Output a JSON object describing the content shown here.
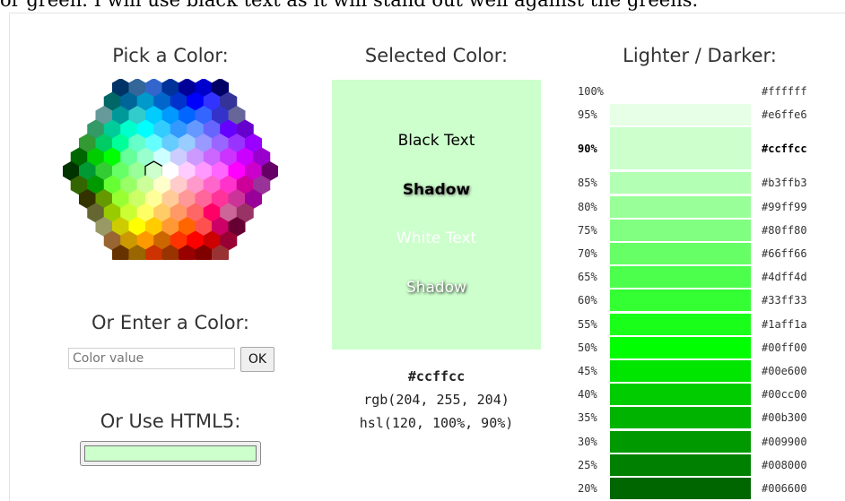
{
  "page_intro": "or green. I will use black text as it will stand out well against the greens.",
  "picker": {
    "heading": "Pick a Color:",
    "hex_colors": [
      [
        "#003366",
        "#336699",
        "#3366CC",
        "#003399",
        "#000099",
        "#0000CC",
        "#000066"
      ],
      [
        "#006666",
        "#006699",
        "#0099CC",
        "#0066CC",
        "#0033CC",
        "#0000FF",
        "#3333FF",
        "#333399"
      ],
      [
        "#669999",
        "#009999",
        "#33CCCC",
        "#00CCFF",
        "#0099FF",
        "#0066FF",
        "#3366FF",
        "#3333CC",
        "#666699"
      ],
      [
        "#339966",
        "#00CC99",
        "#00FFCC",
        "#00FFFF",
        "#33CCFF",
        "#3399FF",
        "#6699FF",
        "#6666FF",
        "#6600FF",
        "#6600CC"
      ],
      [
        "#339933",
        "#00CC66",
        "#00FF99",
        "#66FFCC",
        "#66FFFF",
        "#66CCFF",
        "#99CCFF",
        "#9999FF",
        "#9966FF",
        "#9933FF",
        "#9900FF"
      ],
      [
        "#006600",
        "#00CC00",
        "#00FF00",
        "#66FF99",
        "#99FFCC",
        "#CCFFFF",
        "#CCCCFF",
        "#CC99FF",
        "#CC66FF",
        "#CC33FF",
        "#CC00FF",
        "#9900CC"
      ],
      [
        "#003300",
        "#009933",
        "#33CC33",
        "#66FF66",
        "#99FF99",
        "#CCFFCC",
        "#FFFFFF",
        "#FFCCFF",
        "#FF99FF",
        "#FF66FF",
        "#FF00FF",
        "#CC00CC",
        "#660066"
      ],
      [
        "#336600",
        "#009900",
        "#66FF33",
        "#99FF66",
        "#CCFF99",
        "#FFFFCC",
        "#FFCCCC",
        "#FF99CC",
        "#FF66CC",
        "#FF33CC",
        "#CC0099",
        "#993399"
      ],
      [
        "#333300",
        "#669900",
        "#99FF33",
        "#CCFF66",
        "#FFFF99",
        "#FFCC99",
        "#FF9999",
        "#FF6699",
        "#FF3399",
        "#CC3399",
        "#990099"
      ],
      [
        "#666633",
        "#99CC00",
        "#CCFF33",
        "#FFFF66",
        "#FFCC66",
        "#FF9966",
        "#FF6666",
        "#FF0066",
        "#CC6699",
        "#993366"
      ],
      [
        "#999966",
        "#CCCC00",
        "#FFFF00",
        "#FFCC00",
        "#FF9933",
        "#FF6600",
        "#FF5050",
        "#CC0066",
        "#660033"
      ],
      [
        "#996633",
        "#CC9900",
        "#FF9900",
        "#CC6600",
        "#FF3300",
        "#FF0000",
        "#CC0000",
        "#990033"
      ],
      [
        "#663300",
        "#996600",
        "#CC3300",
        "#993300",
        "#990000",
        "#800000",
        "#993333"
      ]
    ],
    "selected_hex": "#CCFFCC"
  },
  "enter": {
    "heading": "Or Enter a Color:",
    "placeholder": "Color value",
    "ok_label": "OK"
  },
  "html5": {
    "heading": "Or Use HTML5:",
    "value": "#ccffcc"
  },
  "selected": {
    "heading": "Selected Color:",
    "color": "#ccffcc",
    "black_text": "Black Text",
    "black_shadow": "Shadow",
    "white_text": "White Text",
    "white_shadow": "Shadow",
    "hex": "#ccffcc",
    "rgb": "rgb(204, 255, 204)",
    "hsl": "hsl(120, 100%, 90%)"
  },
  "shades": {
    "heading": "Lighter / Darker:",
    "rows": [
      {
        "pct": "100%",
        "hex": "#ffffff",
        "selected": false
      },
      {
        "pct": "95%",
        "hex": "#e6ffe6",
        "selected": false
      },
      {
        "pct": "90%",
        "hex": "#ccffcc",
        "selected": true
      },
      {
        "pct": "85%",
        "hex": "#b3ffb3",
        "selected": false
      },
      {
        "pct": "80%",
        "hex": "#99ff99",
        "selected": false
      },
      {
        "pct": "75%",
        "hex": "#80ff80",
        "selected": false
      },
      {
        "pct": "70%",
        "hex": "#66ff66",
        "selected": false
      },
      {
        "pct": "65%",
        "hex": "#4dff4d",
        "selected": false
      },
      {
        "pct": "60%",
        "hex": "#33ff33",
        "selected": false
      },
      {
        "pct": "55%",
        "hex": "#1aff1a",
        "selected": false
      },
      {
        "pct": "50%",
        "hex": "#00ff00",
        "selected": false
      },
      {
        "pct": "45%",
        "hex": "#00e600",
        "selected": false
      },
      {
        "pct": "40%",
        "hex": "#00cc00",
        "selected": false
      },
      {
        "pct": "35%",
        "hex": "#00b300",
        "selected": false
      },
      {
        "pct": "30%",
        "hex": "#009900",
        "selected": false
      },
      {
        "pct": "25%",
        "hex": "#008000",
        "selected": false
      },
      {
        "pct": "20%",
        "hex": "#006600",
        "selected": false
      }
    ]
  }
}
